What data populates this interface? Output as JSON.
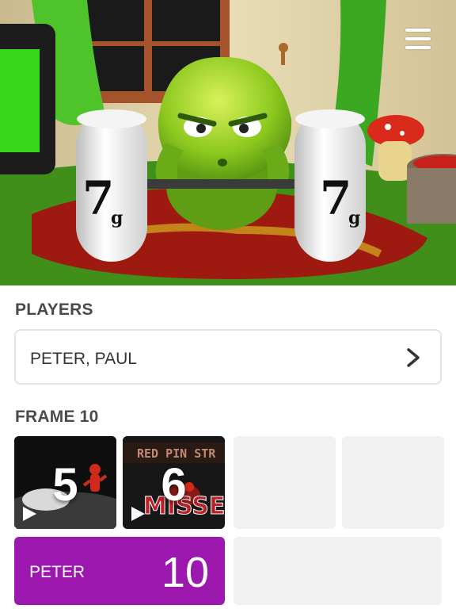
{
  "hero": {
    "weight_left": "7",
    "weight_left_unit": "g",
    "weight_right": "7",
    "weight_right_unit": "g"
  },
  "header": {
    "menu_icon": "hamburger-menu-icon"
  },
  "players": {
    "label": "PLAYERS",
    "value": "PETER, PAUL",
    "chevron_icon": "chevron-right-icon"
  },
  "frame": {
    "label": "FRAME 10",
    "videos": [
      {
        "number": "5",
        "icon": "play-icon"
      },
      {
        "number": "6",
        "icon": "play-icon",
        "banner": "RED PIN STR",
        "caption": "MISSE"
      }
    ]
  },
  "score": {
    "player": "PETER",
    "value": "10",
    "accent": "#9b17ad"
  }
}
